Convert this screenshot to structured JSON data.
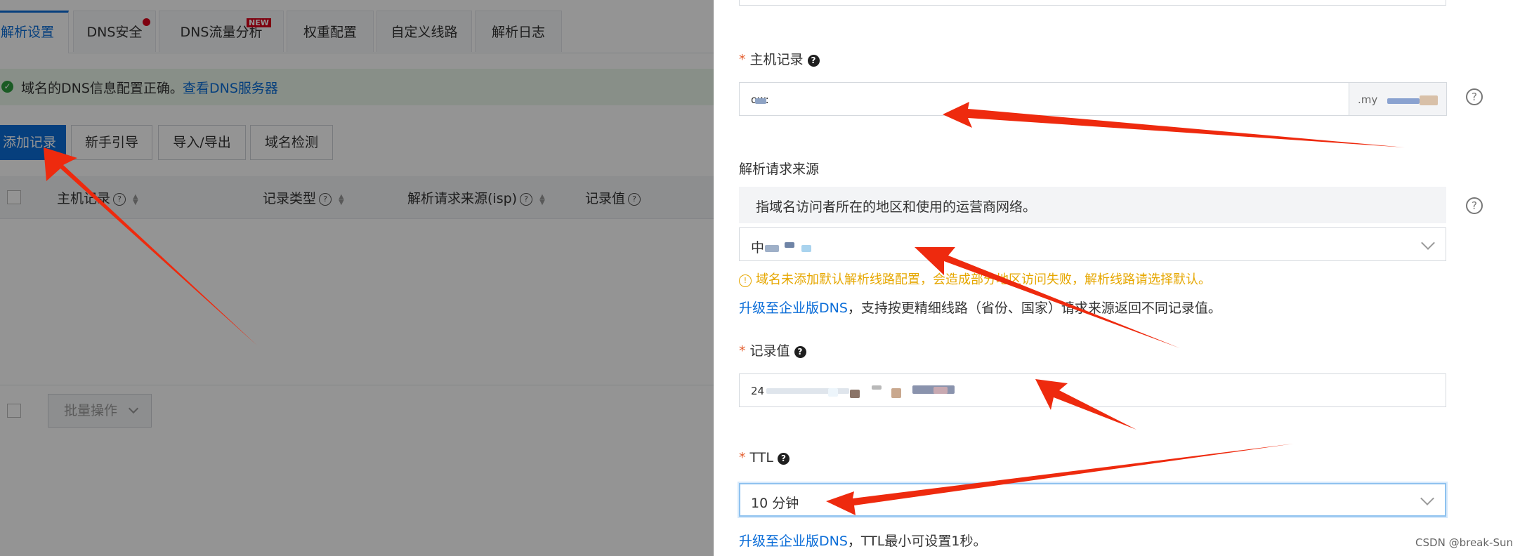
{
  "tabs": [
    {
      "label": "解析设置",
      "active": true
    },
    {
      "label": "DNS安全",
      "badge_dot": true
    },
    {
      "label": "DNS流量分析",
      "badge": "NEW"
    },
    {
      "label": "权重配置"
    },
    {
      "label": "自定义线路"
    },
    {
      "label": "解析日志"
    }
  ],
  "notice": {
    "text": "域名的DNS信息配置正确。",
    "link": "查看DNS服务器"
  },
  "toolbar": {
    "add": "添加记录",
    "guide": "新手引导",
    "import_export": "导入/导出",
    "check": "域名检测"
  },
  "table": {
    "headers": [
      "主机记录",
      "记录类型",
      "解析请求来源(isp)",
      "记录值"
    ],
    "batch": "批量操作"
  },
  "form": {
    "host": {
      "label": "主机记录",
      "value": "ow:",
      "suffix": ".my"
    },
    "source": {
      "label": "解析请求来源",
      "description": "指域名访问者所在的地区和使用的运营商网络。",
      "value": "中",
      "warning": "域名未添加默认解析线路配置，会造成部分地区访问失败，解析线路请选择默认。",
      "upgrade_link": "升级至企业版DNS",
      "upgrade_text": "，支持按更精细线路（省份、国家）请求来源返回不同记录值。"
    },
    "record_value": {
      "label": "记录值",
      "value": "24"
    },
    "ttl": {
      "label": "TTL",
      "value": "10 分钟",
      "upgrade_link": "升级至企业版DNS",
      "upgrade_text": "，TTL最小可设置1秒。"
    }
  },
  "watermark": "CSDN @break-Sun",
  "colors": {
    "accent": "#0b6dd8",
    "warning": "#e6a700",
    "arrow": "#ee2a0e"
  }
}
